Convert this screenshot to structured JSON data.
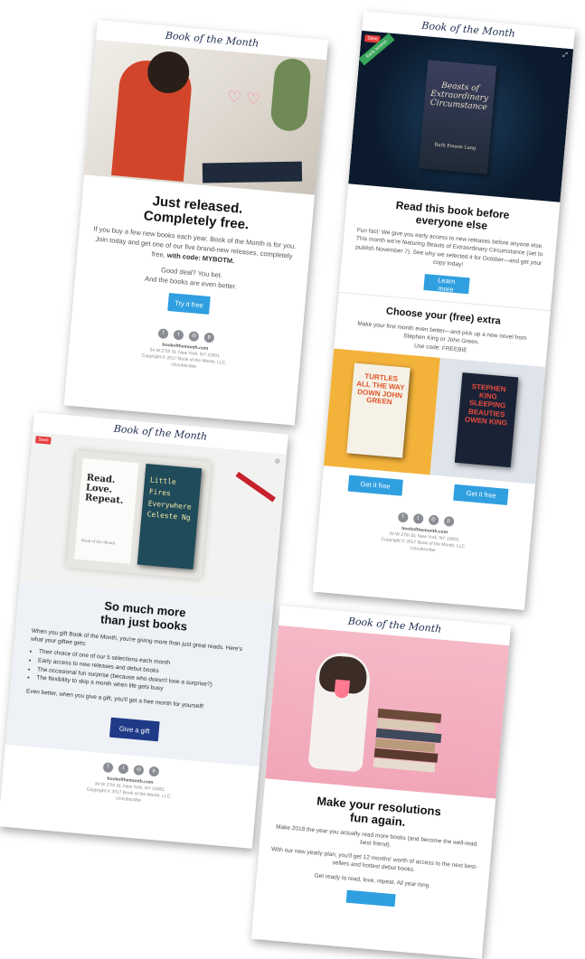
{
  "brand": "Book of the Month",
  "card1": {
    "title_line1": "Just released.",
    "title_line2": "Completely free.",
    "body": "If you buy a few new books each year, Book of the Month is for you. Join today and get one of our five brand-new releases, completely free,",
    "code_text": "with code: MYBOTM.",
    "body2_line1": "Good deal? You bet.",
    "body2_line2": "And the books are even better.",
    "button": "Try it free"
  },
  "card2": {
    "save": "Save",
    "ribbon": "Early access",
    "book_title": "Beasts of Extraordinary Circumstance",
    "book_author": "Ruth Emmie Lang",
    "title_line1": "Read this book before",
    "title_line2": "everyone else",
    "body": "Fun fact: We give you early access to new releases before anyone else. This month we're featuring Beasts of Extraordinary Circumstance (set to publish November 7). See why we selected it for October—and get your copy today!",
    "button": "Learn more",
    "extra_title": "Choose your (free) extra",
    "extra_body": "Make your first month even better—and pick up a new novel from Stephen King or John Green.",
    "extra_code": "Use code: FREEBIE",
    "book_a": "TURTLES ALL THE WAY DOWN JOHN GREEN",
    "book_b": "STEPHEN KING SLEEPING BEAUTIES OWEN KING",
    "button_a": "Get it free",
    "button_b": "Get it free"
  },
  "card3": {
    "save": "Save",
    "box_text": "Read. Love. Repeat.",
    "box_sub": "Book of the Month",
    "book_text": "Little Fires Everywhere Celeste Ng",
    "title_line1": "So much more",
    "title_line2": "than just books",
    "intro": "When you gift Book of the Month, you're giving more than just great reads. Here's what your giftee gets:",
    "bullets": [
      "Their choice of one of our 5 selections each month",
      "Early access to new releases and debut books",
      "The occasional fun surprise (because who doesn't love a surprise?)",
      "The flexibility to skip a month when life gets busy"
    ],
    "outro": "Even better, when you give a gift, you'll get a free month for yourself!",
    "button": "Give a gift"
  },
  "card4": {
    "title_line1": "Make your resolutions",
    "title_line2": "fun again.",
    "body1": "Make 2018 the year you actually read more books (and become the well-read best friend).",
    "body2": "With our new yearly plan, you'll get 12 months' worth of access to the next best-sellers and hottest debut books.",
    "body3": "Get ready to read, love, repeat. All year long."
  },
  "footer": {
    "site": "bookofthemonth.com",
    "address": "34 W 27th St, New York, NY 10001",
    "copyright": "Copyright © 2017 Book of the Month, LLC.",
    "unsubscribe": "Unsubscribe"
  },
  "social_icons": [
    "facebook-icon",
    "twitter-icon",
    "instagram-icon",
    "pinterest-icon"
  ],
  "colors": {
    "accent": "#2f9fe0",
    "navy": "#1f3a87",
    "brand": "#1d2b4f",
    "save": "#e43c3c"
  }
}
